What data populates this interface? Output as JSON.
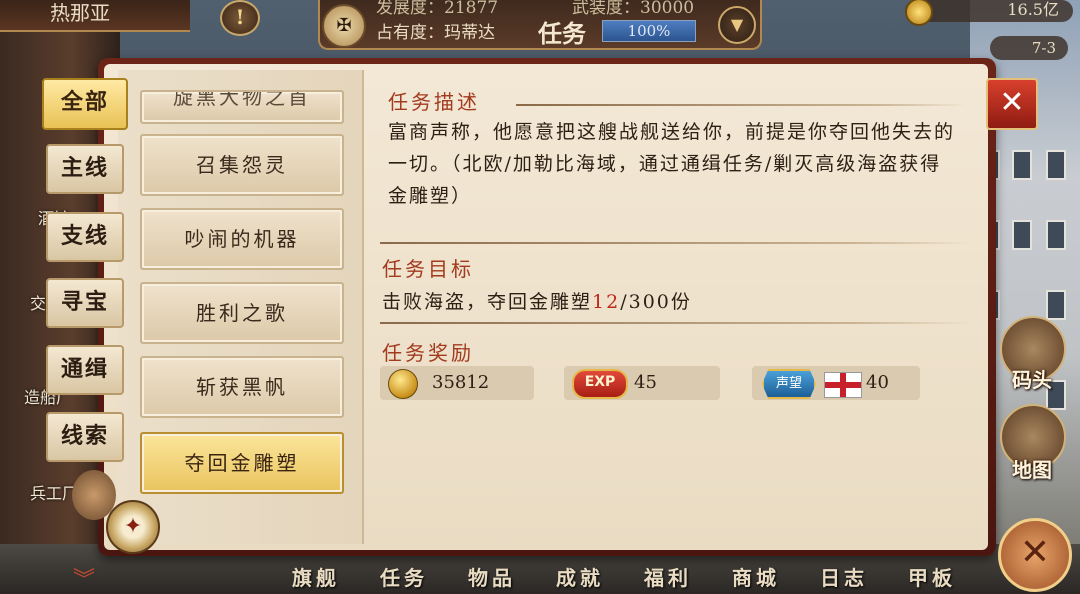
{
  "top": {
    "player_name": "热那亚",
    "alert_glyph": "!",
    "dev_label": "发展度：21877",
    "mil_label": "武装度：30000",
    "occupancy_label": "占有度：玛蒂达",
    "title": "任务",
    "progress_text": "100%",
    "progress_value": 1.0,
    "gold": "16.5亿",
    "day": "7-3"
  },
  "categories": [
    {
      "label": "全部",
      "active": true
    },
    {
      "label": "主线",
      "active": false
    },
    {
      "label": "支线",
      "active": false
    },
    {
      "label": "寻宝",
      "active": false
    },
    {
      "label": "通缉",
      "active": false
    },
    {
      "label": "线索",
      "active": false
    }
  ],
  "side_labels": {
    "tavern": "酒馆",
    "trade": "交",
    "shipyard": "造船厂",
    "armory": "兵工厂"
  },
  "quests": [
    {
      "label": "旋黑大物之首",
      "partial": true
    },
    {
      "label": "召集怨灵",
      "selected": false
    },
    {
      "label": "吵闹的机器",
      "selected": false
    },
    {
      "label": "胜利之歌",
      "selected": false
    },
    {
      "label": "斩获黑帆",
      "selected": false
    },
    {
      "label": "夺回金雕塑",
      "selected": true
    }
  ],
  "detail": {
    "desc_title": "任务描述",
    "desc_text": "富商声称，他愿意把这艘战舰送给你，前提是你夺回他失去的一切。（北欧/加勒比海域，通过通缉任务/剿灭高级海盗获得金雕塑）",
    "goal_title": "任务目标",
    "goal_prefix": "击败海盗，夺回金雕塑",
    "goal_current": "12",
    "goal_suffix": "/300份",
    "reward_title": "任务奖励",
    "rewards": [
      {
        "icon": "gold-coin-icon",
        "value": "35812"
      },
      {
        "icon": "exp-icon",
        "icon_text": "EXP",
        "value": "45"
      },
      {
        "icon": "fame-icon",
        "icon_text": "声望",
        "value": "40",
        "flag": "england-flag-icon"
      }
    ]
  },
  "right_buttons": [
    {
      "label": "码头",
      "icon": "dock-icon"
    },
    {
      "label": "地图",
      "icon": "map-scroll-icon"
    }
  ],
  "bottom_nav": [
    "旗舰",
    "任务",
    "物品",
    "成就",
    "福利",
    "商城",
    "日志",
    "甲板"
  ],
  "colors": {
    "panel_frame": "#6b2418",
    "parchment": "#f3e8d6",
    "section_title": "#a23a1e",
    "selected_item": "#e9c45e",
    "goal_count": "#c0281c"
  }
}
